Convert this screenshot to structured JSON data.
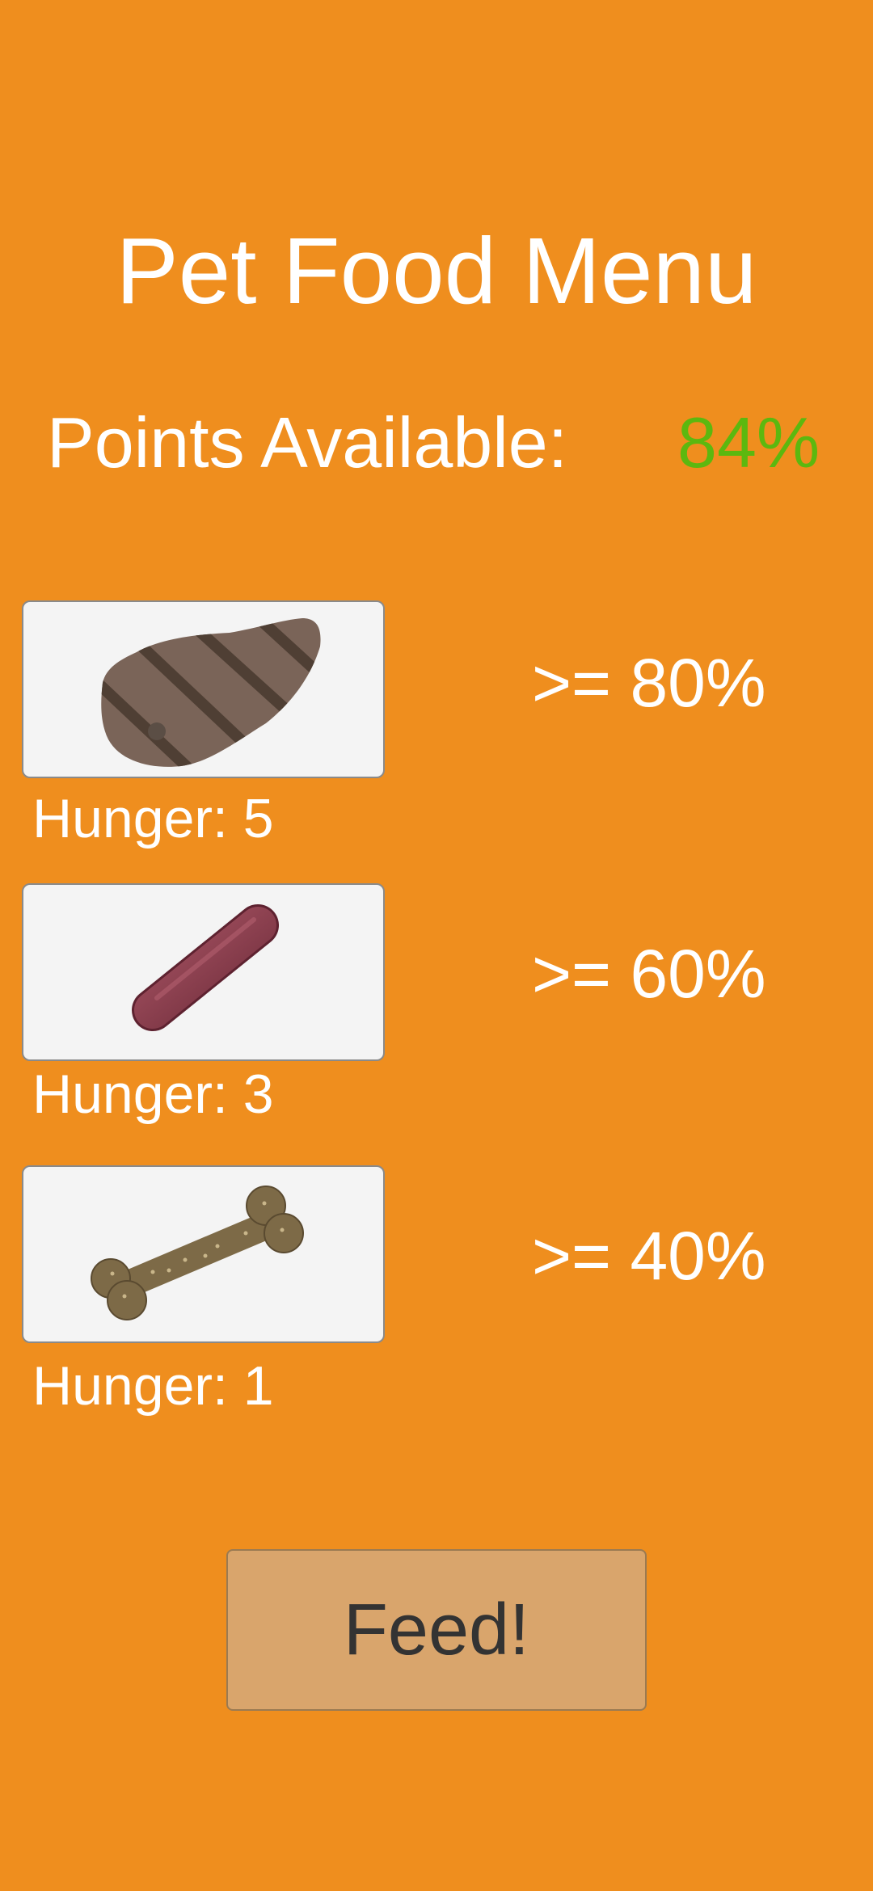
{
  "title": "Pet Food Menu",
  "points": {
    "label": "Points Available:",
    "value": "84%",
    "value_color": "#5CB80F"
  },
  "foods": [
    {
      "name": "steak",
      "icon": "steak-icon",
      "hunger_label": "Hunger: 5",
      "threshold": ">= 80%"
    },
    {
      "name": "sausage",
      "icon": "sausage-icon",
      "hunger_label": "Hunger: 3",
      "threshold": ">= 60%"
    },
    {
      "name": "bone",
      "icon": "bone-icon",
      "hunger_label": "Hunger: 1",
      "threshold": ">= 40%"
    }
  ],
  "feed_button": {
    "label": "Feed!"
  },
  "colors": {
    "background": "#EF8E1E",
    "card": "#F4F4F4",
    "button": "#D9A56C",
    "text": "#FFFFFF"
  }
}
